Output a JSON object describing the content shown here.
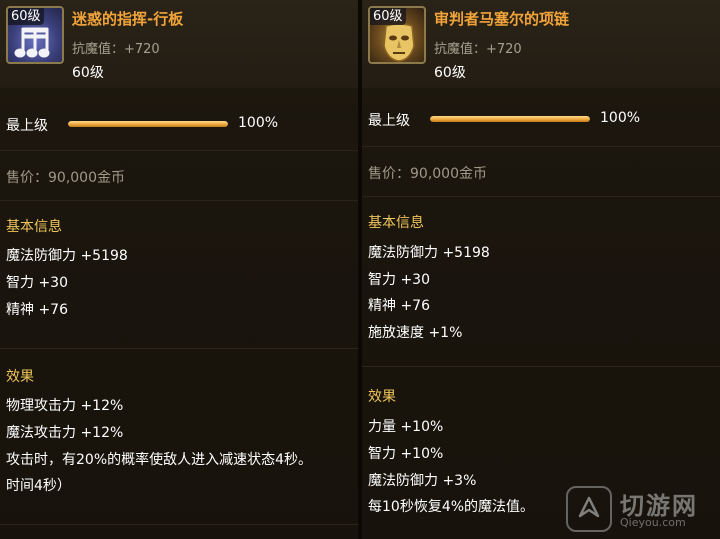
{
  "left": {
    "level_badge": "60级",
    "name": "迷惑的指挥-行板",
    "resist": "抗魔值：+720",
    "req_level": "60级",
    "grade_label": "最上级",
    "grade_percent": "100%",
    "grade_value": 1.0,
    "sell_price": "售价：90,000金币",
    "basic_title": "基本信息",
    "basic_stats": [
      "魔法防御力 +5198",
      "智力 +30",
      "精神 +76"
    ],
    "effect_title": "效果",
    "effects": [
      "物理攻击力 +12%",
      "魔法攻击力 +12%",
      "攻击时，有20%的概率使敌人进入减速状态4秒。",
      "时间4秒）"
    ]
  },
  "right": {
    "level_badge": "60级",
    "name": "审判者马塞尔的项链",
    "resist": "抗魔值：+720",
    "req_level": "60级",
    "grade_label": "最上级",
    "grade_percent": "100%",
    "grade_value": 1.0,
    "sell_price": "售价：90,000金币",
    "basic_title": "基本信息",
    "basic_stats": [
      "魔法防御力 +5198",
      "智力 +30",
      "精神 +76",
      "施放速度 +1%"
    ],
    "effect_title": "效果",
    "effects": [
      "力量 +10%",
      "智力 +10%",
      "魔法防御力 +3%",
      "每10秒恢复4%的魔法值。"
    ]
  },
  "watermark": {
    "text": "切游网",
    "sub": "Qieyou.com"
  },
  "icons": {
    "left_item": "music-notes-icon",
    "right_item": "golden-mask-icon",
    "watermark": "watermark-logo-icon"
  },
  "colors": {
    "item_name": "#f2a43a",
    "section_title": "#f0c65a",
    "grade_bar": "#e9a53a"
  }
}
